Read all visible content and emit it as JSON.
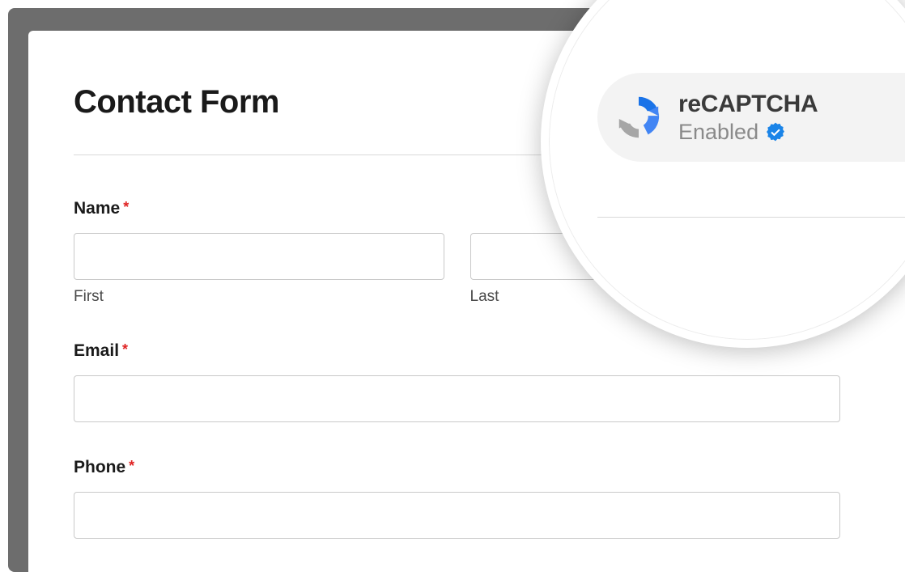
{
  "form": {
    "title": "Contact Form",
    "fields": {
      "name": {
        "label": "Name",
        "first_sublabel": "First",
        "last_sublabel": "Last"
      },
      "email": {
        "label": "Email"
      },
      "phone": {
        "label": "Phone"
      }
    },
    "required_marker": "*"
  },
  "callout": {
    "title": "reCAPTCHA",
    "status": "Enabled",
    "icon": "recaptcha-icon",
    "badge": "verified-icon"
  },
  "colors": {
    "recaptcha_blue": "#4285f4",
    "recaptcha_dark_blue": "#1a73e8",
    "recaptcha_gray": "#a6a6a6",
    "verified_badge": "#1a84e8",
    "required": "#e02424"
  }
}
